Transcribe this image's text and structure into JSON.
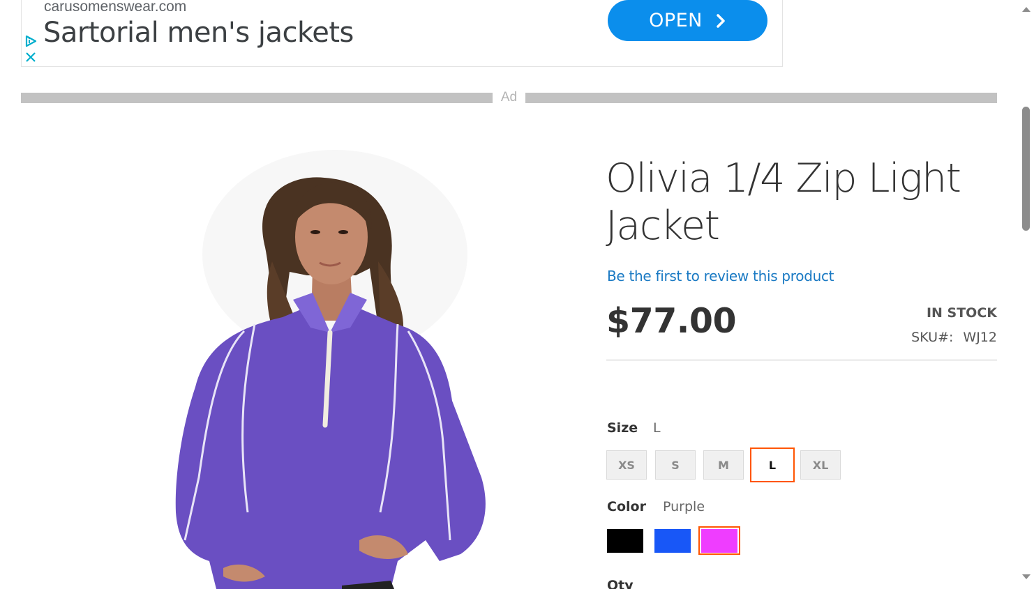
{
  "ad": {
    "domain": "carusomenswear.com",
    "headline": "Sartorial men's jackets",
    "cta_label": "OPEN",
    "separator_label": "Ad"
  },
  "product": {
    "title_line1": "Olivia 1/4 Zip Light",
    "title_line2": "Jacket",
    "review_link": "Be the first to review this product",
    "price": "$77.00",
    "stock": "IN STOCK",
    "sku_label": "SKU#:",
    "sku_value": "WJ12",
    "image_alt": "woman wearing purple quarter-zip jacket"
  },
  "size": {
    "label": "Size",
    "selected": "L",
    "options": [
      "XS",
      "S",
      "M",
      "L",
      "XL"
    ]
  },
  "color": {
    "label": "Color",
    "selected": "Purple",
    "options": [
      {
        "name": "Black",
        "hex": "#000000"
      },
      {
        "name": "Blue",
        "hex": "#1857f7"
      },
      {
        "name": "Purple",
        "hex": "#ef3dff"
      }
    ]
  },
  "qty": {
    "label": "Qty"
  },
  "colors": {
    "accent_link": "#1979c3",
    "selection_outline": "#ff5501",
    "ad_button": "#0b8eec",
    "garment_purple": "#6a4fc2"
  }
}
